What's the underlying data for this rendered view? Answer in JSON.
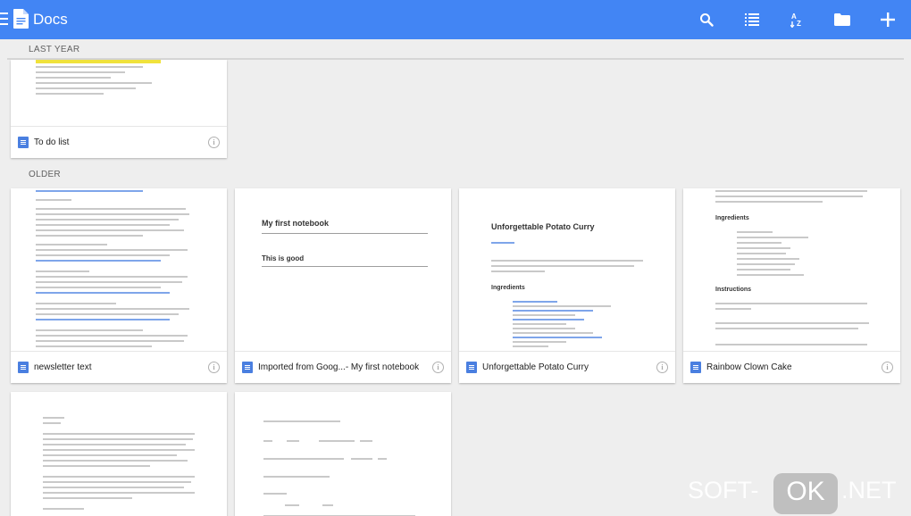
{
  "app": {
    "title": "Docs"
  },
  "toolbar": {
    "icons": [
      "search-icon",
      "list-view-icon",
      "sort-az-icon",
      "folder-icon",
      "add-icon"
    ]
  },
  "sections": [
    {
      "label": "LAST YEAR"
    },
    {
      "label": "OLDER"
    }
  ],
  "cards": [
    {
      "title": "To do list"
    },
    {
      "title": "newsletter text"
    },
    {
      "title": "Imported from Goog...- My first notebook"
    },
    {
      "title": "Unforgettable Potato Curry"
    },
    {
      "title": "Rainbow Clown Cake"
    }
  ],
  "previews": {
    "notebook_heading": "My first notebook",
    "notebook_line": "This is good",
    "curry_heading": "Unforgettable Potato Curry",
    "curry_section": "Ingredients",
    "cake_section_1": "Ingredients",
    "cake_section_2": "Instructions"
  },
  "watermark": {
    "left": "SOFT-",
    "ok": "OK",
    "right": ".NET"
  },
  "colors": {
    "appbar": "#4285f4",
    "background": "#eeeeee",
    "doc_icon": "#4a7fe0"
  }
}
